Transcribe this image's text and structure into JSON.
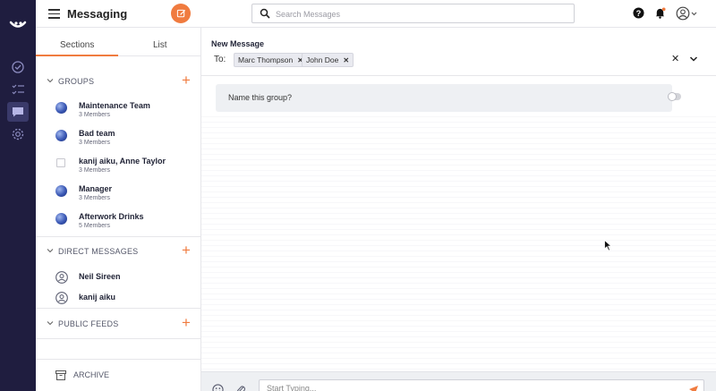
{
  "header": {
    "title": "Messaging",
    "search_placeholder": "Search Messages"
  },
  "rail": {
    "icons": [
      "logo-icon",
      "tasks-done-icon",
      "checklist-icon",
      "chat-icon",
      "settings-icon"
    ],
    "active": "chat-icon"
  },
  "sidebar": {
    "tabs": [
      "Sections",
      "List"
    ],
    "active_tab": "Sections",
    "groups": {
      "label": "GROUPS",
      "items": [
        {
          "name": "Maintenance Team",
          "members": "3 Members"
        },
        {
          "name": "Bad team",
          "members": "3 Members"
        },
        {
          "name": "kanij aiku, Anne Taylor",
          "members": "3 Members"
        },
        {
          "name": "Manager",
          "members": "3 Members"
        },
        {
          "name": "Afterwork Drinks",
          "members": "5 Members"
        }
      ]
    },
    "direct_messages": {
      "label": "DIRECT MESSAGES",
      "items": [
        "Neil Sireen",
        "kanij aiku"
      ]
    },
    "public_feeds": {
      "label": "PUBLIC FEEDS"
    },
    "archive_label": "ARCHIVE"
  },
  "main": {
    "title": "New Message",
    "to_label": "To:",
    "recipients": [
      "Marc Thompson",
      "John Doe"
    ],
    "name_group_label": "Name this group?",
    "composer_placeholder": "Start Typing..."
  },
  "colors": {
    "accent": "#f07b3f",
    "rail_bg": "#1f1d3f"
  }
}
